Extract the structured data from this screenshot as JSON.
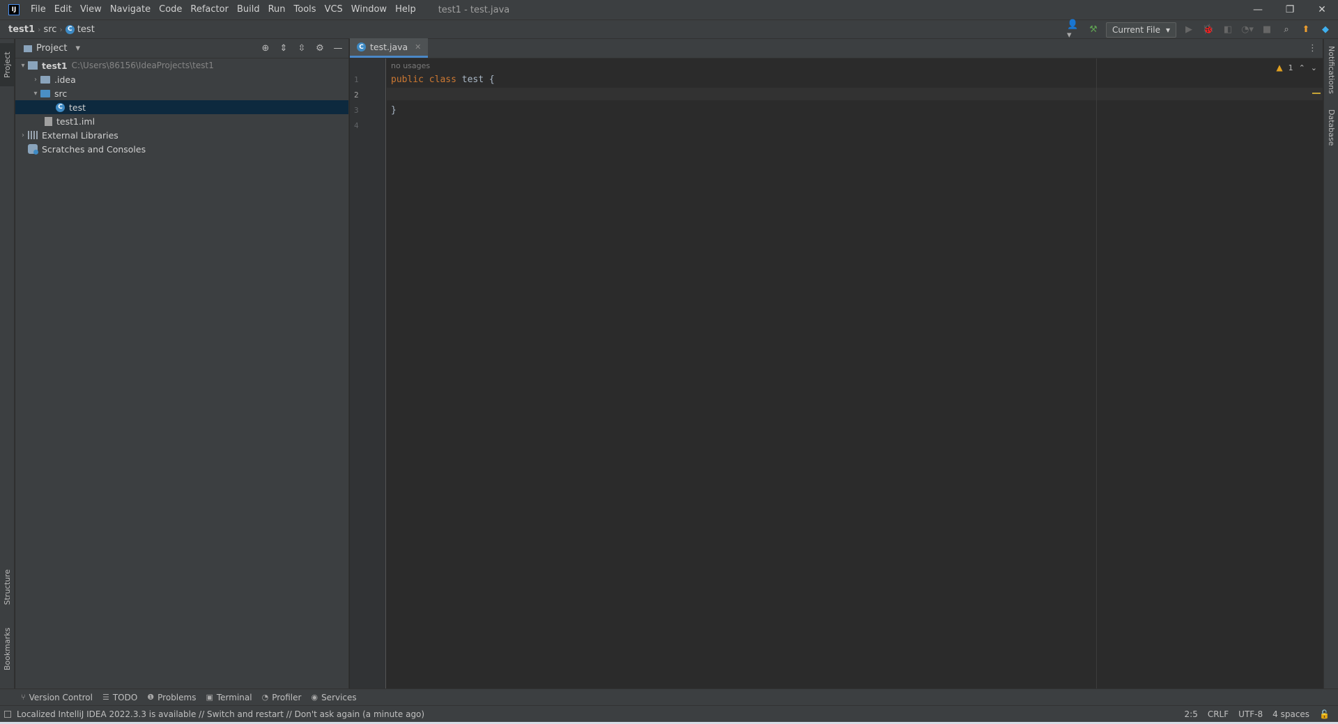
{
  "titlebar": {
    "logo_text": "IJ",
    "menu": [
      "File",
      "Edit",
      "View",
      "Navigate",
      "Code",
      "Refactor",
      "Build",
      "Run",
      "Tools",
      "VCS",
      "Window",
      "Help"
    ],
    "window_title": "test1 - test.java",
    "controls": {
      "minimize": "—",
      "restore": "❐",
      "close": "✕"
    }
  },
  "navbar": {
    "crumbs": [
      "test1",
      "src",
      "test"
    ],
    "badge_letter": "C",
    "run_config": "Current File"
  },
  "left_strip": {
    "top_tab": "Project",
    "bottom_tabs": [
      "Structure",
      "Bookmarks"
    ]
  },
  "right_strip": {
    "tabs": [
      "Notifications",
      "Database"
    ]
  },
  "project_panel": {
    "title": "Project",
    "tree": {
      "root_name": "test1",
      "root_path": "C:\\Users\\86156\\IdeaProjects\\test1",
      "idea": ".idea",
      "src": "src",
      "test_class": "test",
      "iml": "test1.iml",
      "ext_libs": "External Libraries",
      "scratches": "Scratches and Consoles"
    }
  },
  "editor": {
    "tab_label": "test.java",
    "usage_hint": "no usages",
    "line_numbers": [
      "1",
      "2",
      "3",
      "4"
    ],
    "code": {
      "kw_public": "public",
      "kw_class": "class",
      "class_name": "test",
      "open_brace": "{",
      "close_brace": "}"
    },
    "warning_count": "1"
  },
  "bottom_tools": [
    "Version Control",
    "TODO",
    "Problems",
    "Terminal",
    "Profiler",
    "Services"
  ],
  "status": {
    "message": "Localized IntelliJ IDEA 2022.3.3 is available // Switch and restart // Don't ask again (a minute ago)",
    "position": "2:5",
    "line_sep": "CRLF",
    "encoding": "UTF-8",
    "indent": "4 spaces"
  },
  "colors": {
    "accent": "#4a88c7",
    "keyword": "#cc7832",
    "selection": "#0d293e",
    "warning": "#e0a020"
  }
}
